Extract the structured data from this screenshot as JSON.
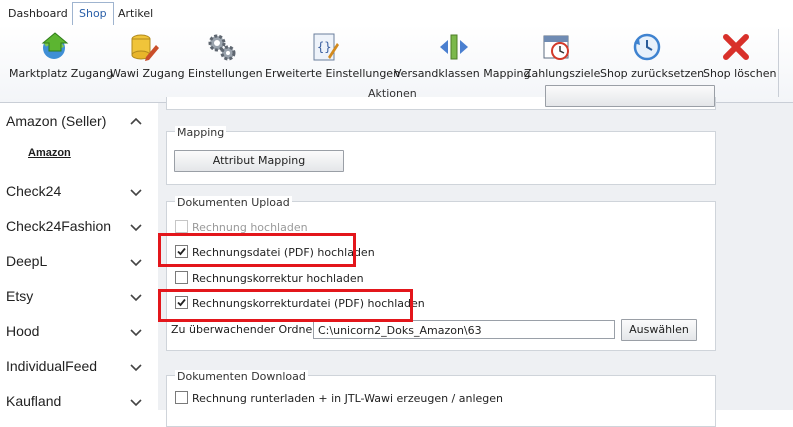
{
  "tabs": [
    {
      "label": "Dashboard",
      "active": false
    },
    {
      "label": "Shop",
      "active": true
    },
    {
      "label": "Artikel",
      "active": false
    }
  ],
  "ribbon": {
    "buttons": [
      {
        "label": "Marktplatz Zugang",
        "icon": "globe-arrow-icon"
      },
      {
        "label": "Wawi Zugang",
        "icon": "database-pencil-icon"
      },
      {
        "label": "Einstellungen",
        "icon": "gears-icon"
      },
      {
        "label": "Erweiterte Einstellungen",
        "icon": "code-document-icon"
      },
      {
        "label": "Versandklassen Mapping",
        "icon": "mapping-arrows-icon"
      },
      {
        "label": "Zahlungsziele",
        "icon": "calendar-clock-icon"
      },
      {
        "label": "Shop zurücksetzen",
        "icon": "reset-clock-icon"
      },
      {
        "label": "Shop löschen",
        "icon": "delete-x-icon"
      }
    ],
    "group_label": "Aktionen"
  },
  "sidebar": {
    "items": [
      {
        "label": "Amazon (Seller)",
        "expanded": true
      },
      {
        "label": "Check24",
        "expanded": false
      },
      {
        "label": "Check24Fashion",
        "expanded": false
      },
      {
        "label": "DeepL",
        "expanded": false
      },
      {
        "label": "Etsy",
        "expanded": false
      },
      {
        "label": "Hood",
        "expanded": false
      },
      {
        "label": "IndividualFeed",
        "expanded": false
      },
      {
        "label": "Kaufland",
        "expanded": false
      }
    ],
    "sub_item": "Amazon"
  },
  "mapping": {
    "title": "Mapping",
    "button": "Attribut Mapping"
  },
  "upload": {
    "title": "Dokumenten Upload",
    "options": [
      {
        "label": "Rechnung hochladen",
        "checked": false,
        "disabled": true
      },
      {
        "label": "Rechnungsdatei (PDF) hochladen",
        "checked": true,
        "disabled": false
      },
      {
        "label": "Rechnungskorrektur hochladen",
        "checked": false,
        "disabled": false
      },
      {
        "label": "Rechnungskorrekturdatei (PDF) hochladen",
        "checked": true,
        "disabled": false
      }
    ],
    "folder_label": "Zu überwachender Ordner:",
    "folder_value": "C:\\unicorn2_Doks_Amazon\\63",
    "browse_button": "Auswählen"
  },
  "download": {
    "title": "Dokumenten Download",
    "options": [
      {
        "label": "Rechnung runterladen + in JTL-Wawi erzeugen / anlegen",
        "checked": false
      }
    ]
  },
  "colors": {
    "highlight": "#e3161b",
    "active_tab": "#2a5fa8"
  }
}
